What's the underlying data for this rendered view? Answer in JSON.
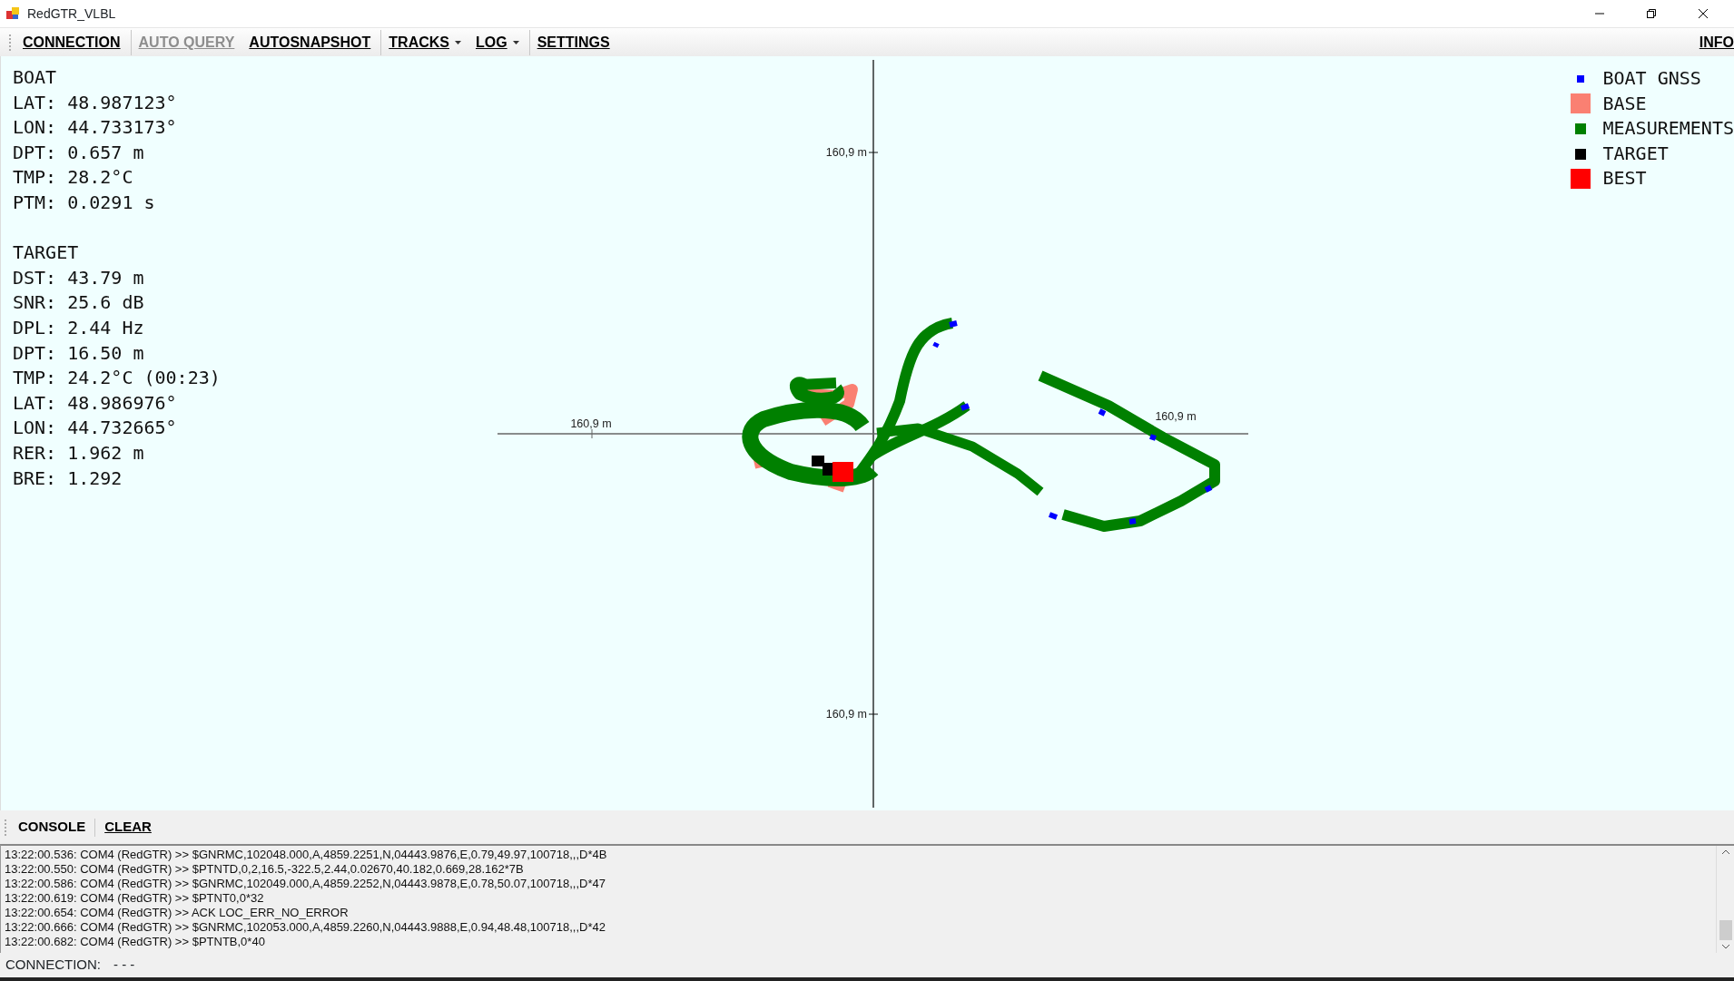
{
  "window": {
    "title": "RedGTR_VLBL"
  },
  "menu": {
    "items": [
      {
        "label": "CONNECTION",
        "disabled": false,
        "dropdown": false,
        "separator_before": false
      },
      {
        "label": "AUTO QUERY",
        "disabled": true,
        "dropdown": false,
        "separator_before": true
      },
      {
        "label": "AUTOSNAPSHOT",
        "disabled": false,
        "dropdown": false,
        "separator_before": false
      },
      {
        "label": "TRACKS",
        "disabled": false,
        "dropdown": true,
        "separator_before": true
      },
      {
        "label": "LOG",
        "disabled": false,
        "dropdown": true,
        "separator_before": false
      },
      {
        "label": "SETTINGS",
        "disabled": false,
        "dropdown": false,
        "separator_before": true
      }
    ],
    "right_item": "INFO"
  },
  "info_panel": [
    {
      "title": "BOAT",
      "lines": [
        "LAT: 48.987123°",
        "LON: 44.733173°",
        "DPT: 0.657 m",
        "TMP: 28.2°C",
        "PTM: 0.0291 s"
      ]
    },
    {
      "title": "TARGET",
      "lines": [
        "DST: 43.79 m",
        "SNR: 25.6 dB",
        "DPL: 2.44 Hz",
        "DPT: 16.50 m",
        "TMP: 24.2°C (00:23)",
        "LAT: 48.986976°",
        "LON: 44.732665°",
        "RER: 1.962 m",
        "BRE: 1.292"
      ]
    }
  ],
  "plot": {
    "axis_labels": {
      "top": "160,9 m",
      "left": "160,9 m",
      "right": "160,9 m",
      "bottom": "160,9 m"
    }
  },
  "legend": [
    {
      "label": "BOAT GNSS",
      "color": "#0000ff",
      "kind": "small"
    },
    {
      "label": "BASE",
      "color": "#fa8072",
      "kind": "large"
    },
    {
      "label": "MEASUREMENTS",
      "color": "#008000",
      "kind": "medium"
    },
    {
      "label": "TARGET",
      "color": "#000000",
      "kind": "medium"
    },
    {
      "label": "BEST",
      "color": "#ff0000",
      "kind": "large"
    }
  ],
  "console": {
    "toolbar": [
      {
        "label": "CONSOLE",
        "kind": "label"
      },
      {
        "label": "CLEAR",
        "kind": "button"
      }
    ],
    "lines": [
      "13:22:00.536: COM4 (RedGTR) >> $GNRMC,102048.000,A,4859.2251,N,04443.9876,E,0.79,49.97,100718,,,D*4B",
      "13:22:00.550: COM4 (RedGTR) >> $PTNTD,0,2,16.5,-322.5,2.44,0.02670,40.182,0.669,28.162*7B",
      "13:22:00.586: COM4 (RedGTR) >> $GNRMC,102049.000,A,4859.2252,N,04443.9878,E,0.78,50.07,100718,,,D*47",
      "13:22:00.619: COM4 (RedGTR) >> $PTNT0,0*32",
      "13:22:00.654: COM4 (RedGTR) >> ACK LOC_ERR_NO_ERROR",
      "13:22:00.666: COM4 (RedGTR) >> $GNRMC,102053.000,A,4859.2260,N,04443.9888,E,0.94,48.48,100718,,,D*42",
      "13:22:00.682: COM4 (RedGTR) >> $PTNTB,0*40"
    ]
  },
  "status_bar": {
    "label": "CONNECTION:",
    "value": "- - -"
  }
}
